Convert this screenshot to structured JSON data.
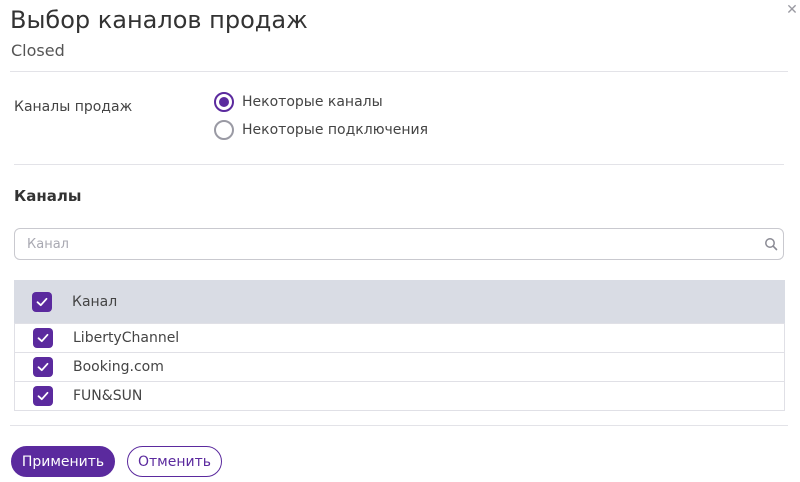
{
  "dialog": {
    "title": "Выбор каналов продаж",
    "subtitle": "Closed",
    "close_icon": "close-icon"
  },
  "sales_channels": {
    "label": "Каналы продаж",
    "options": [
      {
        "label": "Некоторые каналы",
        "selected": true
      },
      {
        "label": "Некоторые подключения",
        "selected": false
      }
    ]
  },
  "channels": {
    "section_title": "Каналы",
    "search": {
      "placeholder": "Канал",
      "value": "",
      "icon": "search-icon"
    },
    "table": {
      "header": {
        "label": "Канал",
        "checked": true
      },
      "rows": [
        {
          "name": "LibertyChannel",
          "checked": true
        },
        {
          "name": "Booking.com",
          "checked": true
        },
        {
          "name": "FUN&SUN",
          "checked": true
        }
      ]
    }
  },
  "actions": {
    "apply_label": "Применить",
    "cancel_label": "Отменить"
  },
  "colors": {
    "accent": "#5b2a9e",
    "header_bg": "#d9dce4",
    "divider": "#e3e3e8"
  }
}
